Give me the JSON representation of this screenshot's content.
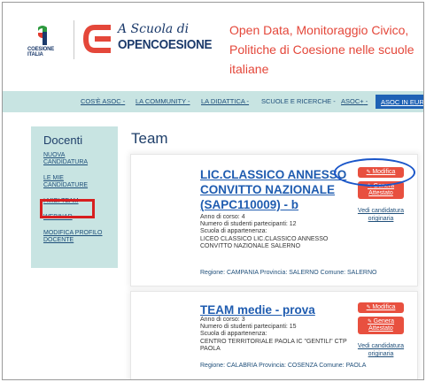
{
  "header": {
    "coesione_logo_text": [
      "COESIONE",
      "ITALIA"
    ],
    "oc_logo_scuola": "A Scuola di",
    "oc_logo_name": "OPENCOESIONE",
    "title_lines": [
      "Open Data, Monitoraggio Civico,",
      "Politiche di Coesione nelle scuole",
      "italiane"
    ]
  },
  "nav": {
    "items": [
      {
        "label": "COS'È ASOC",
        "caret": " -"
      },
      {
        "label": "LA COMMUNITY",
        "caret": " -"
      },
      {
        "label": "LA DIDATTICA",
        "caret": " -"
      },
      {
        "label": "SCUOLE E RICERCHE",
        "caret": " -"
      },
      {
        "label": "ASOC+",
        "caret": " -"
      }
    ],
    "highlight": "ASOC IN EUROPA"
  },
  "sidebar": {
    "title": "Docenti",
    "items": [
      {
        "label": "NUOVA CANDIDATURA"
      },
      {
        "label": "LE MIE CANDIDATURE"
      },
      {
        "label": "I MIEI TEAM"
      },
      {
        "label": "WEBINAR"
      },
      {
        "label": "MODIFICA PROFILO DOCENTE"
      }
    ]
  },
  "main": {
    "page_title": "Team",
    "teams": [
      {
        "name": "LIC.CLASSICO ANNESSO CONVITTO NAZIONALE (SAPC110009) - b",
        "anno": "Anno di corso: 4",
        "studenti": "Numero di studenti partecipanti: 12",
        "scuola_label": "Scuola di appartenenza:",
        "scuola": "LICEO CLASSICO LIC.CLASSICO ANNESSO CONVITTO NAZIONALE SALERNO",
        "regione": "Regione: CAMPANIA   Provincia: SALERNO   Comune: SALERNO",
        "btn_modifica": "Modifica",
        "btn_attestato": "Genera Attestato",
        "link_candidatura": "Vedi candidatura originaria"
      },
      {
        "name": "TEAM medie - prova",
        "anno": "Anno di corso: 3",
        "studenti": "Numero di studenti partecipanti: 15",
        "scuola_label": "Scuola di appartenenza:",
        "scuola": "CENTRO TERRITORIALE PAOLA IC \"GENTILI\" CTP PAOLA",
        "regione": "Regione: CALABRIA   Provincia: COSENZA   Comune: PAOLA",
        "btn_modifica": "Modifica",
        "btn_attestato": "Genera Attestato",
        "link_candidatura": "Vedi candidatura originaria"
      }
    ]
  },
  "colors": {
    "accent_red": "#e8503f",
    "nav_bg": "#c8e4e2",
    "link_blue": "#1f5cb0",
    "annotation_red": "#d71f1f",
    "annotation_blue": "#1a56c9"
  }
}
